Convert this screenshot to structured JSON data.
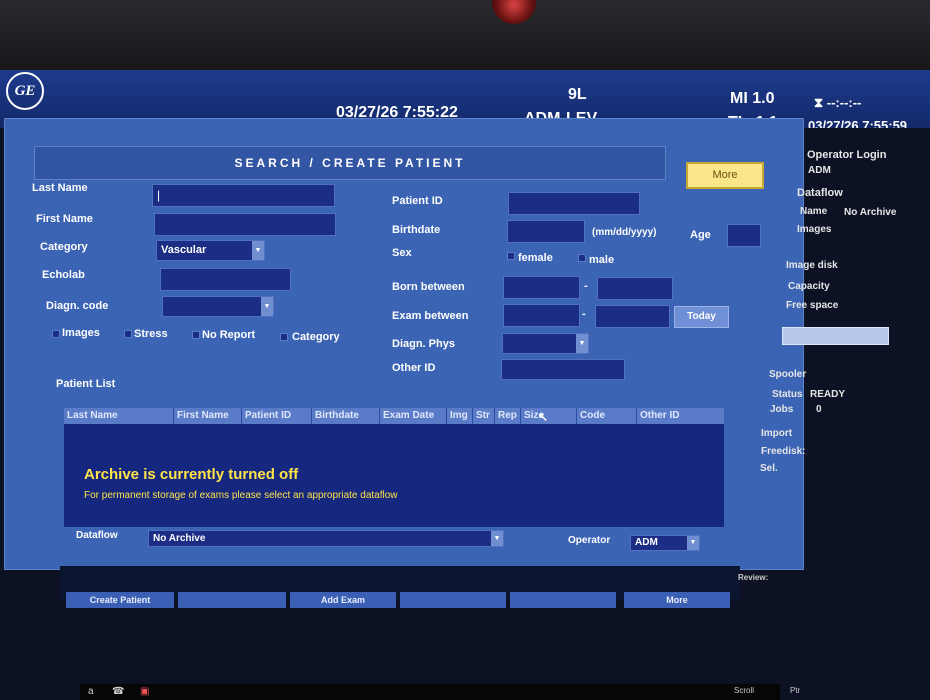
{
  "header": {
    "logo_text": "GE",
    "datetime": "03/27/26 7:55:22",
    "operator": "ADM",
    "probe": "9L",
    "preset": "LEV",
    "mi": "MI 1.0",
    "tis": "TIs 1.1",
    "clock_icon_text": "--:--:--",
    "datetime_right": "03/27/26 7:55:59"
  },
  "form": {
    "title": "SEARCH / CREATE PATIENT",
    "more_label": "More",
    "last_name_label": "Last Name",
    "last_name_value": "|",
    "first_name_label": "First Name",
    "category_label": "Category",
    "category_value": "Vascular",
    "echolab_label": "Echolab",
    "diagn_code_label": "Diagn. code",
    "patient_id_label": "Patient ID",
    "birthdate_label": "Birthdate",
    "birthdate_hint": "(mm/dd/yyyy)",
    "age_label": "Age",
    "sex_label": "Sex",
    "female_label": "female",
    "male_label": "male",
    "born_between_label": "Born between",
    "exam_between_label": "Exam between",
    "today_label": "Today",
    "diagn_phys_label": "Diagn. Phys",
    "other_id_label": "Other ID",
    "dash": "-",
    "checks": [
      "Images",
      "Stress",
      "No Report",
      "Category"
    ]
  },
  "patient_list": {
    "label": "Patient List",
    "columns": [
      "Last Name",
      "First Name",
      "Patient ID",
      "Birthdate",
      "Exam Date",
      "Img",
      "Str",
      "Rep",
      "Size",
      "Code",
      "Other ID"
    ],
    "message_title": "Archive is currently turned off",
    "message_body": "For permanent storage of exams please select an appropriate dataflow"
  },
  "footer": {
    "dataflow_label": "Dataflow",
    "dataflow_value": "No Archive",
    "operator_label": "Operator",
    "operator_value": "ADM",
    "review_label": "Review:"
  },
  "softkeys": [
    "Create Patient",
    "",
    "Add Exam",
    "",
    "",
    "More"
  ],
  "right_panel": {
    "operator_login": "Operator Login",
    "operator_login_value": "ADM",
    "dataflow": "Dataflow",
    "name_label": "Name",
    "name_value": "No Archive",
    "images": "Images",
    "image_disk": "Image disk",
    "capacity": "Capacity",
    "free_space": "Free space",
    "spooler": "Spooler",
    "status_label": "Status",
    "status_value": "READY",
    "jobs_label": "Jobs",
    "jobs_value": "0",
    "import": "Import",
    "freedisk": "Freedisk:",
    "sel": "Sel."
  },
  "taskbar": {
    "item1": "a",
    "scroll": "Scroll",
    "ptr": "Ptr"
  }
}
